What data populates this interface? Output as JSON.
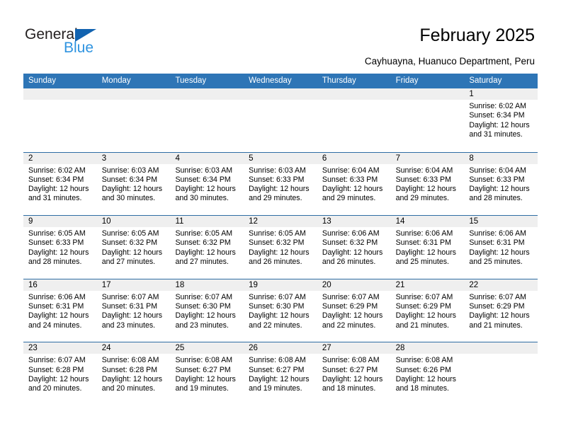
{
  "brand": {
    "name_part1": "General",
    "name_part2": "Blue",
    "color_dark": "#231f20",
    "color_blue": "#2e93e0",
    "triangle_color": "#1263b0"
  },
  "header": {
    "title": "February 2025",
    "subtitle": "Cayhuayna, Huanuco Department, Peru"
  },
  "theme": {
    "header_bg": "#2e75b6",
    "row_divider": "#2e6da4",
    "daynum_band": "#efefef"
  },
  "weekdays": [
    "Sunday",
    "Monday",
    "Tuesday",
    "Wednesday",
    "Thursday",
    "Friday",
    "Saturday"
  ],
  "labels": {
    "sunrise_prefix": "Sunrise:",
    "sunset_prefix": "Sunset:",
    "daylight_prefix": "Daylight:"
  },
  "weeks": [
    [
      {
        "day": "",
        "sunrise": "",
        "sunset": "",
        "daylight": "",
        "empty": true
      },
      {
        "day": "",
        "sunrise": "",
        "sunset": "",
        "daylight": "",
        "empty": true
      },
      {
        "day": "",
        "sunrise": "",
        "sunset": "",
        "daylight": "",
        "empty": true
      },
      {
        "day": "",
        "sunrise": "",
        "sunset": "",
        "daylight": "",
        "empty": true
      },
      {
        "day": "",
        "sunrise": "",
        "sunset": "",
        "daylight": "",
        "empty": true
      },
      {
        "day": "",
        "sunrise": "",
        "sunset": "",
        "daylight": "",
        "empty": true
      },
      {
        "day": "1",
        "sunrise": "Sunrise: 6:02 AM",
        "sunset": "Sunset: 6:34 PM",
        "daylight": "Daylight: 12 hours and 31 minutes.",
        "empty": false
      }
    ],
    [
      {
        "day": "2",
        "sunrise": "Sunrise: 6:02 AM",
        "sunset": "Sunset: 6:34 PM",
        "daylight": "Daylight: 12 hours and 31 minutes.",
        "empty": false
      },
      {
        "day": "3",
        "sunrise": "Sunrise: 6:03 AM",
        "sunset": "Sunset: 6:34 PM",
        "daylight": "Daylight: 12 hours and 30 minutes.",
        "empty": false
      },
      {
        "day": "4",
        "sunrise": "Sunrise: 6:03 AM",
        "sunset": "Sunset: 6:34 PM",
        "daylight": "Daylight: 12 hours and 30 minutes.",
        "empty": false
      },
      {
        "day": "5",
        "sunrise": "Sunrise: 6:03 AM",
        "sunset": "Sunset: 6:33 PM",
        "daylight": "Daylight: 12 hours and 29 minutes.",
        "empty": false
      },
      {
        "day": "6",
        "sunrise": "Sunrise: 6:04 AM",
        "sunset": "Sunset: 6:33 PM",
        "daylight": "Daylight: 12 hours and 29 minutes.",
        "empty": false
      },
      {
        "day": "7",
        "sunrise": "Sunrise: 6:04 AM",
        "sunset": "Sunset: 6:33 PM",
        "daylight": "Daylight: 12 hours and 29 minutes.",
        "empty": false
      },
      {
        "day": "8",
        "sunrise": "Sunrise: 6:04 AM",
        "sunset": "Sunset: 6:33 PM",
        "daylight": "Daylight: 12 hours and 28 minutes.",
        "empty": false
      }
    ],
    [
      {
        "day": "9",
        "sunrise": "Sunrise: 6:05 AM",
        "sunset": "Sunset: 6:33 PM",
        "daylight": "Daylight: 12 hours and 28 minutes.",
        "empty": false
      },
      {
        "day": "10",
        "sunrise": "Sunrise: 6:05 AM",
        "sunset": "Sunset: 6:32 PM",
        "daylight": "Daylight: 12 hours and 27 minutes.",
        "empty": false
      },
      {
        "day": "11",
        "sunrise": "Sunrise: 6:05 AM",
        "sunset": "Sunset: 6:32 PM",
        "daylight": "Daylight: 12 hours and 27 minutes.",
        "empty": false
      },
      {
        "day": "12",
        "sunrise": "Sunrise: 6:05 AM",
        "sunset": "Sunset: 6:32 PM",
        "daylight": "Daylight: 12 hours and 26 minutes.",
        "empty": false
      },
      {
        "day": "13",
        "sunrise": "Sunrise: 6:06 AM",
        "sunset": "Sunset: 6:32 PM",
        "daylight": "Daylight: 12 hours and 26 minutes.",
        "empty": false
      },
      {
        "day": "14",
        "sunrise": "Sunrise: 6:06 AM",
        "sunset": "Sunset: 6:31 PM",
        "daylight": "Daylight: 12 hours and 25 minutes.",
        "empty": false
      },
      {
        "day": "15",
        "sunrise": "Sunrise: 6:06 AM",
        "sunset": "Sunset: 6:31 PM",
        "daylight": "Daylight: 12 hours and 25 minutes.",
        "empty": false
      }
    ],
    [
      {
        "day": "16",
        "sunrise": "Sunrise: 6:06 AM",
        "sunset": "Sunset: 6:31 PM",
        "daylight": "Daylight: 12 hours and 24 minutes.",
        "empty": false
      },
      {
        "day": "17",
        "sunrise": "Sunrise: 6:07 AM",
        "sunset": "Sunset: 6:31 PM",
        "daylight": "Daylight: 12 hours and 23 minutes.",
        "empty": false
      },
      {
        "day": "18",
        "sunrise": "Sunrise: 6:07 AM",
        "sunset": "Sunset: 6:30 PM",
        "daylight": "Daylight: 12 hours and 23 minutes.",
        "empty": false
      },
      {
        "day": "19",
        "sunrise": "Sunrise: 6:07 AM",
        "sunset": "Sunset: 6:30 PM",
        "daylight": "Daylight: 12 hours and 22 minutes.",
        "empty": false
      },
      {
        "day": "20",
        "sunrise": "Sunrise: 6:07 AM",
        "sunset": "Sunset: 6:29 PM",
        "daylight": "Daylight: 12 hours and 22 minutes.",
        "empty": false
      },
      {
        "day": "21",
        "sunrise": "Sunrise: 6:07 AM",
        "sunset": "Sunset: 6:29 PM",
        "daylight": "Daylight: 12 hours and 21 minutes.",
        "empty": false
      },
      {
        "day": "22",
        "sunrise": "Sunrise: 6:07 AM",
        "sunset": "Sunset: 6:29 PM",
        "daylight": "Daylight: 12 hours and 21 minutes.",
        "empty": false
      }
    ],
    [
      {
        "day": "23",
        "sunrise": "Sunrise: 6:07 AM",
        "sunset": "Sunset: 6:28 PM",
        "daylight": "Daylight: 12 hours and 20 minutes.",
        "empty": false
      },
      {
        "day": "24",
        "sunrise": "Sunrise: 6:08 AM",
        "sunset": "Sunset: 6:28 PM",
        "daylight": "Daylight: 12 hours and 20 minutes.",
        "empty": false
      },
      {
        "day": "25",
        "sunrise": "Sunrise: 6:08 AM",
        "sunset": "Sunset: 6:27 PM",
        "daylight": "Daylight: 12 hours and 19 minutes.",
        "empty": false
      },
      {
        "day": "26",
        "sunrise": "Sunrise: 6:08 AM",
        "sunset": "Sunset: 6:27 PM",
        "daylight": "Daylight: 12 hours and 19 minutes.",
        "empty": false
      },
      {
        "day": "27",
        "sunrise": "Sunrise: 6:08 AM",
        "sunset": "Sunset: 6:27 PM",
        "daylight": "Daylight: 12 hours and 18 minutes.",
        "empty": false
      },
      {
        "day": "28",
        "sunrise": "Sunrise: 6:08 AM",
        "sunset": "Sunset: 6:26 PM",
        "daylight": "Daylight: 12 hours and 18 minutes.",
        "empty": false
      },
      {
        "day": "",
        "sunrise": "",
        "sunset": "",
        "daylight": "",
        "empty": true
      }
    ]
  ]
}
